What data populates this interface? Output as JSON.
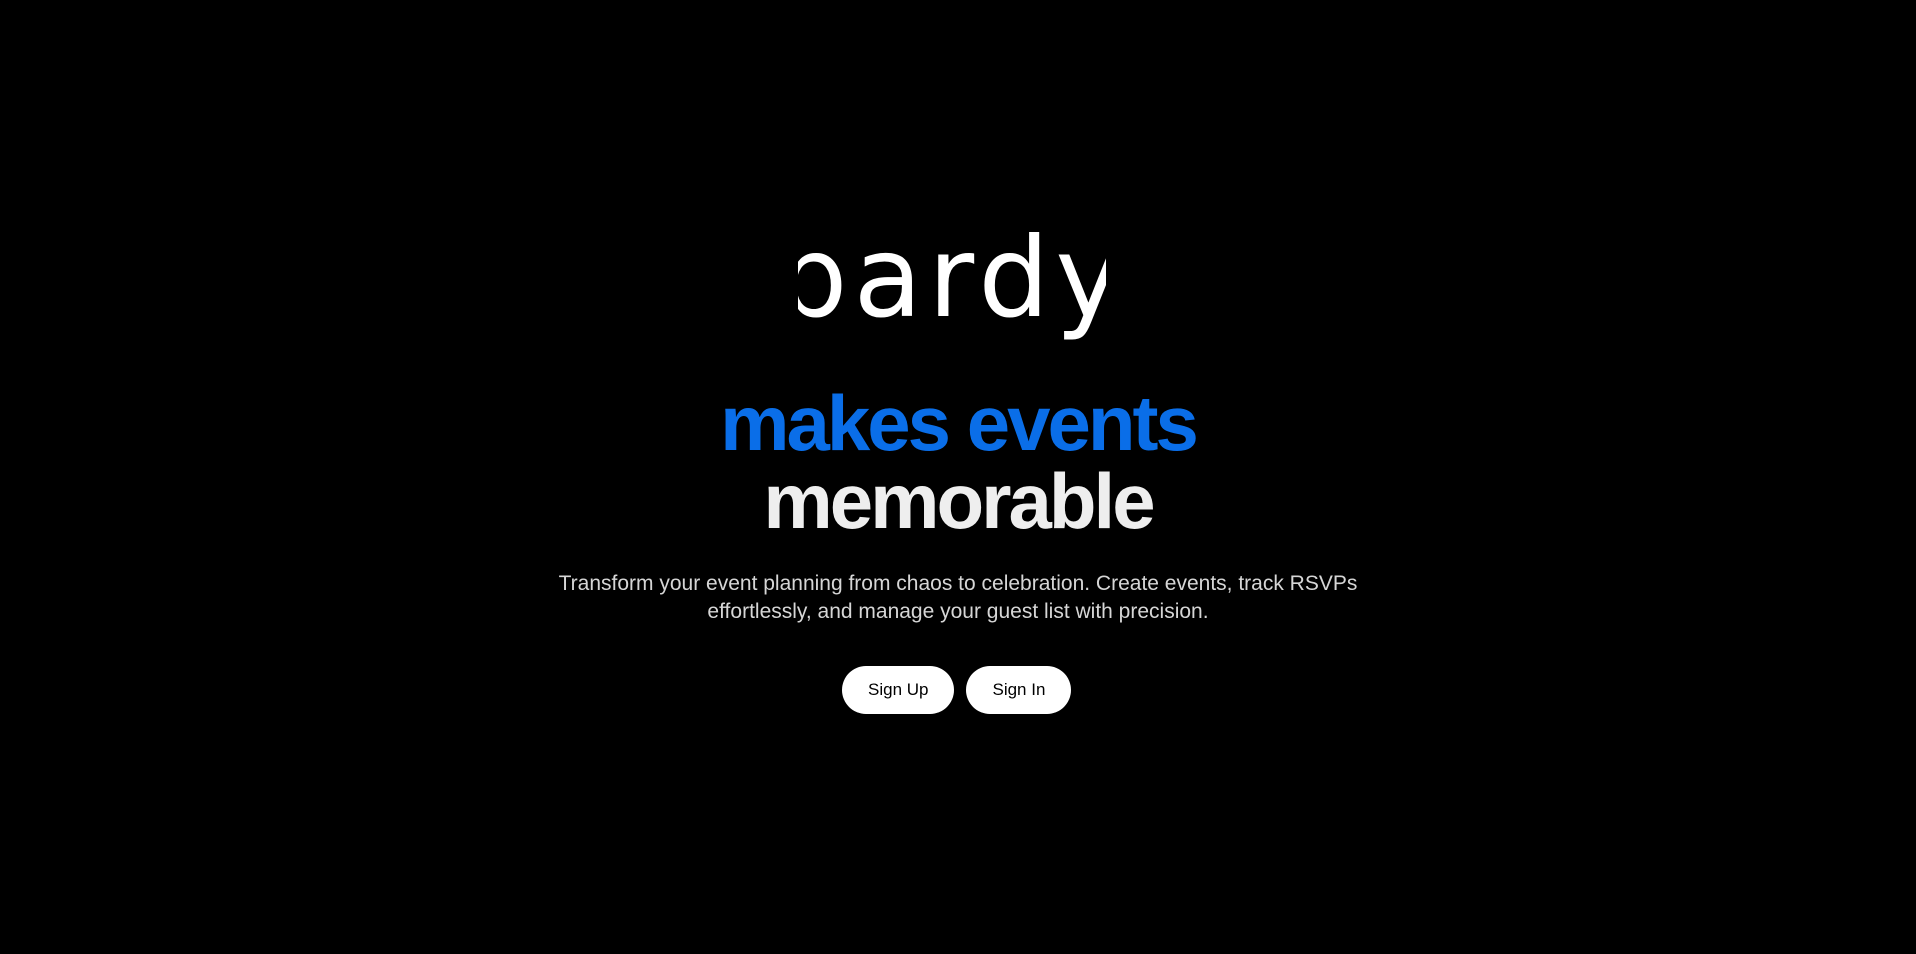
{
  "brand": {
    "logo_text": "pardy",
    "logo_color": "#ffffff"
  },
  "hero": {
    "headline_accent": "makes events",
    "headline_main": "memorable",
    "tagline_line1": "Transform your event planning from chaos to celebration. Create events, track RSVPs",
    "tagline_line2": "effortlessly, and manage your guest list with precision."
  },
  "actions": {
    "sign_up_label": "Sign Up",
    "sign_in_label": "Sign In"
  },
  "colors": {
    "background": "#000000",
    "accent": "#0a6ee8",
    "headline": "#eeeeee",
    "body_text": "#d6d6d6",
    "button_bg": "#ffffff",
    "button_text": "#000000"
  }
}
